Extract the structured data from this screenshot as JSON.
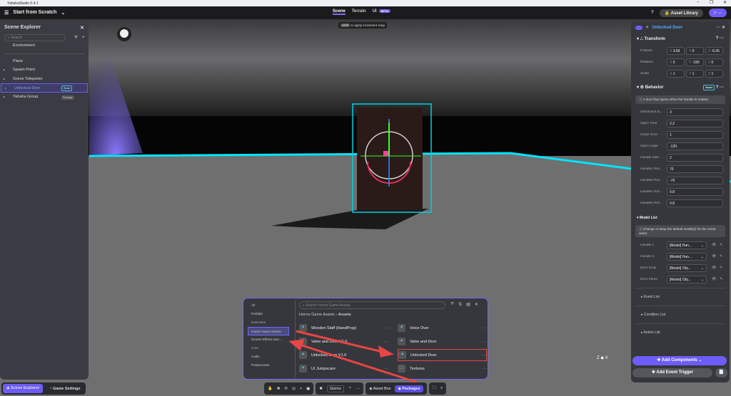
{
  "window": {
    "title": "YahahaStudio 0.4.1"
  },
  "topbar": {
    "project": "Start from Scratch",
    "tabs": [
      "Scene",
      "Terrain",
      "UI"
    ],
    "beta": "BETA",
    "help": "?",
    "asset_library": "Asset Library"
  },
  "hint": {
    "key": "Shift",
    "text": "to apply increment snap"
  },
  "scene_explorer": {
    "title": "Scene Explorer",
    "search_placeholder": "Search",
    "items": [
      {
        "label": "Environment"
      },
      {
        "label": "Plane"
      },
      {
        "label": "Spawn Point"
      },
      {
        "label": "Scene Teleporter"
      },
      {
        "label": "Unlocked Door",
        "badges": [
          "Smart",
          "Package"
        ]
      },
      {
        "label": "Yahaha Group"
      }
    ]
  },
  "inspector": {
    "object_name": "Unlocked Door",
    "transform": {
      "title": "Transform",
      "rows": [
        {
          "label": "Position",
          "x": "3.69",
          "y": "0",
          "z": "-6.35"
        },
        {
          "label": "Rotation",
          "x": "0",
          "y": "-180",
          "z": "0"
        },
        {
          "label": "Scale",
          "x": "1",
          "y": "1",
          "z": "1"
        }
      ]
    },
    "behavior": {
      "title": "Behavior",
      "badge": "Smart",
      "info": "A door that opens when the handle is rotated.",
      "fields": [
        {
          "label": "Interaction D...",
          "value": "3"
        },
        {
          "label": "Open Time",
          "value": "2.2"
        },
        {
          "label": "Close Time",
          "value": "1"
        },
        {
          "label": "Open Angle",
          "value": "-120"
        },
        {
          "label": "Handle Inter...",
          "value": "2"
        },
        {
          "label": "Handle1 Rot...",
          "value": "70"
        },
        {
          "label": "Handle2 Rot...",
          "value": "-70"
        },
        {
          "label": "Handle1 Rot...",
          "value": "0.8"
        },
        {
          "label": "Handle2 Rot...",
          "value": "0.8"
        }
      ]
    },
    "model_list": {
      "title": "Model List",
      "info": "Change or keep the default model(s) for the smart asset.",
      "rows": [
        {
          "label": "Handle 1",
          "value": "[Model] Han..."
        },
        {
          "label": "Handle 2",
          "value": "[Model] Han..."
        },
        {
          "label": "Door body",
          "value": "[Model] Obj..."
        },
        {
          "label": "Door frame",
          "value": "[Model] Obj..."
        }
      ]
    },
    "sections": [
      "Event List",
      "Condition List",
      "Action List"
    ],
    "add_components": "Add Components",
    "add_event_trigger": "Add Event Trigger"
  },
  "asset_panel": {
    "categories": [
      {
        "label": "All"
      },
      {
        "label": "Prefabs"
      },
      {
        "label": "Extension",
        "header": true
      },
      {
        "label": "Horror Game Assets",
        "selected": true
      },
      {
        "label": "Screen Effects and ..."
      },
      {
        "label": "Core",
        "header": true
      },
      {
        "label": "Audio"
      },
      {
        "label": "Postprocess"
      }
    ],
    "search_placeholder": "Search Horror Game Assets",
    "breadcrumb": [
      "Horror Game Assets",
      "Assets"
    ],
    "items": [
      {
        "label": "Wooden Staff (HandProp)"
      },
      {
        "label": "Voice Over"
      },
      {
        "label": "Valve and Door V1.0"
      },
      {
        "label": "Valve and Door"
      },
      {
        "label": "Unlocked Door V1.0"
      },
      {
        "label": "Unlocked Door"
      },
      {
        "label": "UI Jumpscare"
      },
      {
        "label": "Textures"
      }
    ]
  },
  "toolbar": {
    "gizmo": "Gizmo",
    "asset_box": "Asset Box",
    "packages": "Packages"
  },
  "bottom_tabs": {
    "scene_explorer": "Scene Explorer",
    "game_settings": "Game Settings"
  },
  "colors": {
    "accent": "#6d5cf5",
    "selection": "#00e5ff",
    "highlight": "#e84545"
  }
}
